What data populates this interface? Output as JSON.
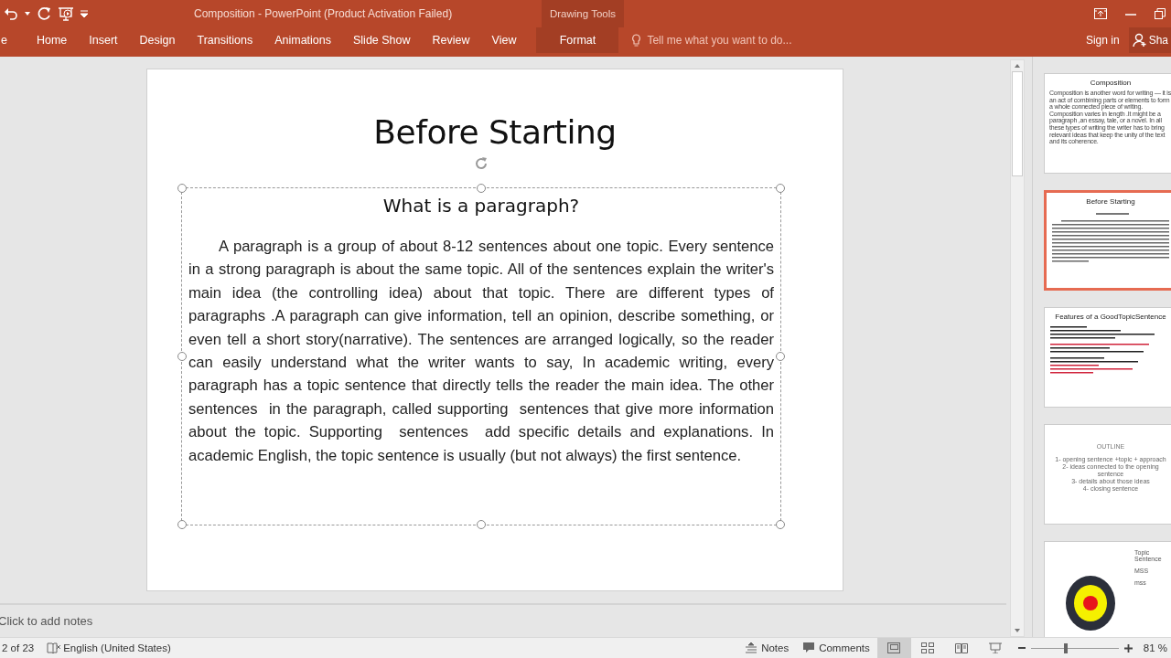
{
  "window": {
    "title": "Composition - PowerPoint (Product Activation Failed)",
    "context_group": "Drawing Tools"
  },
  "ribbon_tabs": [
    {
      "label": "e",
      "selected": false,
      "contextual": false
    },
    {
      "label": "Home",
      "selected": false,
      "contextual": false
    },
    {
      "label": "Insert",
      "selected": false,
      "contextual": false
    },
    {
      "label": "Design",
      "selected": false,
      "contextual": false
    },
    {
      "label": "Transitions",
      "selected": false,
      "contextual": false
    },
    {
      "label": "Animations",
      "selected": false,
      "contextual": false
    },
    {
      "label": "Slide Show",
      "selected": false,
      "contextual": false
    },
    {
      "label": "Review",
      "selected": false,
      "contextual": false
    },
    {
      "label": "View",
      "selected": false,
      "contextual": false
    },
    {
      "label": "Format",
      "selected": false,
      "contextual": true
    }
  ],
  "tell_me": {
    "placeholder": "Tell me what you want to do..."
  },
  "account": {
    "sign_in": "Sign in",
    "share": "Sha"
  },
  "slide": {
    "title": "Before Starting",
    "subtitle": "What is a paragraph?",
    "body": "A paragraph is a group of about 8-12 sentences about one topic. Every sentence in a strong paragraph is about the same topic. All of the sentences explain the writer's main idea (the controlling idea) about that topic. There are different types of paragraphs .A paragraph can give information, tell an opinion, describe something, or even tell a short story(narrative). The sentences are arranged logically, so the reader can easily understand what the writer wants to say, In academic writing, every paragraph has a topic sentence that directly tells the reader the main idea. The other sentences  in the paragraph, called supporting  sentences that give more information about the topic. Supporting  sentences  add specific details and explanations. In academic English, the topic sentence is usually (but not always) the first sentence."
  },
  "notes": {
    "placeholder": "Click to add notes"
  },
  "thumbnails": [
    {
      "kind": "text",
      "selected": false,
      "title": "Composition",
      "lines": [
        "Composition is another word for writing — it is an act of combining parts or elements to form a whole connected piece of writing. Composition varies in length .It might be a paragraph ,an essay, tale, or a novel. In all these types of writing the writer has to bring relevant ideas that keep the unity of the text and its coherence."
      ]
    },
    {
      "kind": "paragraph",
      "selected": true,
      "title": "Before Starting"
    },
    {
      "kind": "list",
      "selected": false,
      "title": "Features of a GoodTopicSentence"
    },
    {
      "kind": "outline",
      "selected": false,
      "title": "OUTLINE",
      "lines": [
        "1- opening sentence +topic + approach",
        "2- ideas connected to the opening sentence",
        "3- details about those ideas",
        "4- closing sentence"
      ]
    },
    {
      "kind": "target",
      "selected": false,
      "lines": [
        "Topic Sentence",
        "MSS",
        "mss"
      ]
    }
  ],
  "status_bar": {
    "slide_count": "2 of 23",
    "language": "English (United States)",
    "notes": "Notes",
    "comments": "Comments",
    "views": [
      {
        "kind": "normal",
        "selected": true
      },
      {
        "kind": "sorter",
        "selected": false
      },
      {
        "kind": "reading",
        "selected": false
      },
      {
        "kind": "show",
        "selected": false
      }
    ],
    "zoom": {
      "level": 0.4,
      "reading": "81 %"
    }
  }
}
